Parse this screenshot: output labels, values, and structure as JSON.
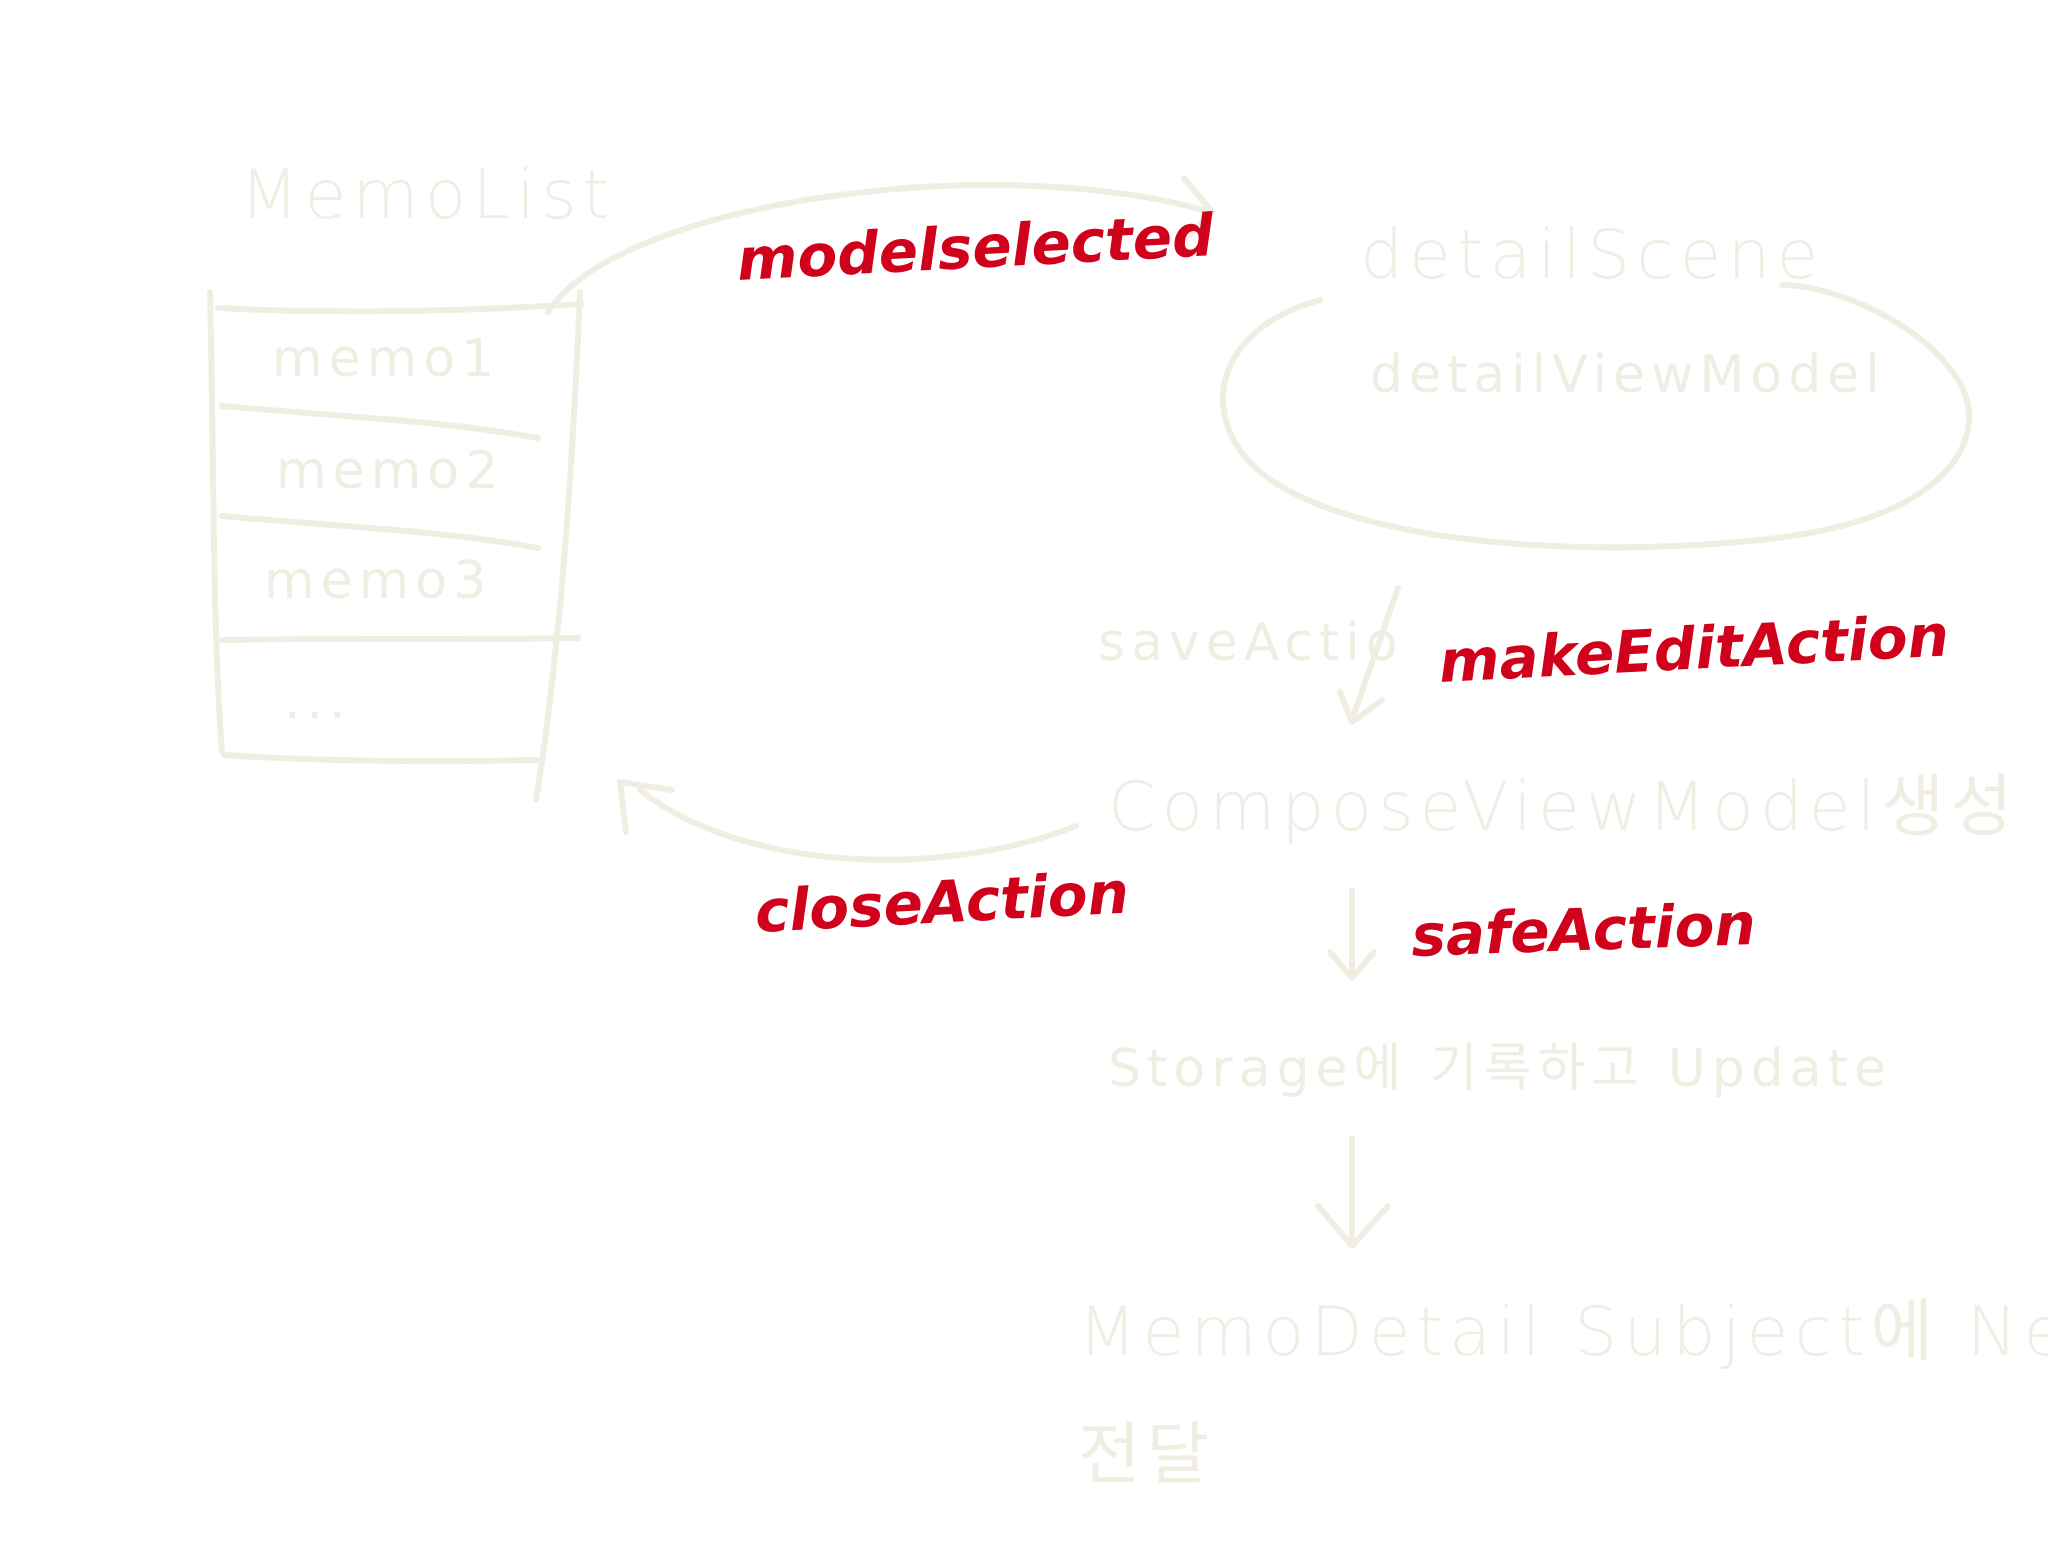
{
  "memo_list": {
    "title": "MemoList",
    "items": [
      "memo1",
      "memo2",
      "memo3",
      "..."
    ]
  },
  "detail_scene": {
    "title": "detailScene",
    "view_model": "detailViewModel"
  },
  "flow": {
    "side_note": "saveActio",
    "compose_step": "ComposeViewModel생성",
    "storage_step": "Storage에 기록하고 Update",
    "subject_step_line1": "MemoDetail Subject에 Next",
    "subject_step_line2": "전달"
  },
  "actions": {
    "model_selected": "modelselected",
    "make_edit_action": "makeEditAction",
    "close_action": "closeAction",
    "safe_action": "safeAction"
  },
  "colors": {
    "highlight": "#d0021b",
    "faint": "#f0eee3"
  }
}
